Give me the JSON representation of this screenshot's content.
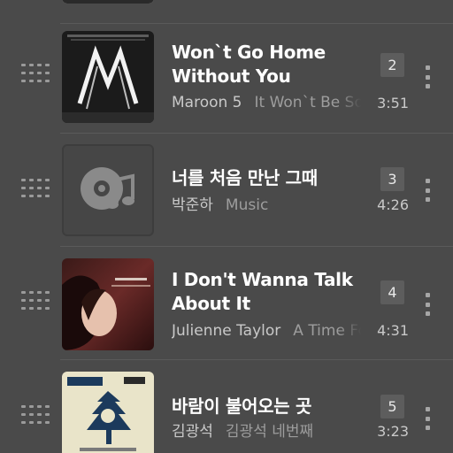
{
  "tracks": [
    {
      "number": "2",
      "title": "Won`t Go Home Without You",
      "artist": "Maroon 5",
      "album": "It Won`t Be Soon Before Long",
      "duration": "3:51",
      "art_icon": "maroon5-album-art"
    },
    {
      "number": "3",
      "title": "너를 처음 만난 그때",
      "artist": "박준하",
      "album": "Music",
      "duration": "4:26",
      "art_icon": "music-placeholder-icon"
    },
    {
      "number": "4",
      "title": "I Don't Wanna Talk About It",
      "artist": "Julienne Taylor",
      "album": "A Time For Love",
      "duration": "4:31",
      "art_icon": "julienne-taylor-album-art"
    },
    {
      "number": "5",
      "title": "바람이 불어오는 곳",
      "artist": "김광석",
      "album": "김광석 네번째",
      "duration": "3:23",
      "art_icon": "kim-kwang-seok-album-art"
    }
  ],
  "colors": {
    "background": "#4a4a4a",
    "title": "#ffffff",
    "secondary": "#c9c9c9",
    "album_text": "#9d9d9d",
    "badge_bg": "#5d5d5d"
  }
}
